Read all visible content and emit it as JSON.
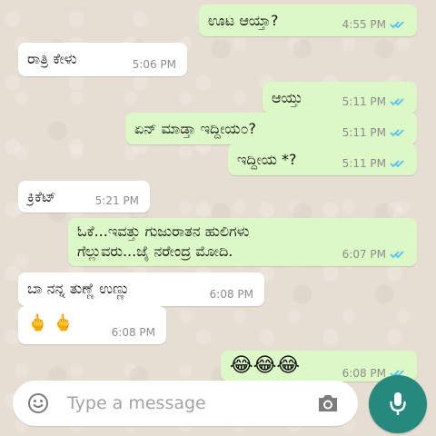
{
  "messages": [
    {
      "text": "ಊಟ ಆಯ್ತಾ?",
      "time": "4:55 PM",
      "direction": "outgoing",
      "status": "read"
    },
    {
      "text": "ರಾತ್ರಿ ಕೇಳು",
      "time": "5:06 PM",
      "direction": "incoming"
    },
    {
      "text": "ಆಯ್ತು",
      "time": "5:11 PM",
      "direction": "outgoing",
      "status": "read"
    },
    {
      "text": "ಏನ್ ಮಾಡ್ತಾ ಇದ್ದೀಯ೦?",
      "time": "5:11 PM",
      "direction": "outgoing",
      "status": "read"
    },
    {
      "text": "ಇದ್ದೀಯ *?",
      "time": "5:11 PM",
      "direction": "outgoing",
      "status": "read"
    },
    {
      "text": "ಕ್ರಿಕೆಟ್",
      "time": "5:21 PM",
      "direction": "incoming"
    },
    {
      "text_line1": "ಓಕೆ...ಇವತ್ತು ಗುಜುರಾತನ ಹುಲಿಗಳು",
      "text_line2": "ಗೆಲ್ಲುವರು...ಜೈ ನರೇಂದ್ರ ಮೋದಿ.",
      "time": "6:07 PM",
      "direction": "outgoing",
      "status": "read"
    },
    {
      "text": "ಬಾ ನನ್ನ ತುಣ್ಣೆ ಉಣ್ಣು",
      "time": "6:08 PM",
      "direction": "incoming"
    },
    {
      "text": "🖕 🖕",
      "time": "6:08 PM",
      "direction": "incoming"
    },
    {
      "text": "😂😂😂",
      "time": "6:08 PM",
      "direction": "outgoing",
      "status": "read"
    }
  ],
  "composer": {
    "placeholder": "Type a message",
    "emoji_icon": "emoji-icon",
    "camera_icon": "camera-icon",
    "mic_icon": "mic-icon"
  },
  "colors": {
    "background": "#e7ded3",
    "outgoing_bubble": "#dcf8c6",
    "incoming_bubble": "#ffffff",
    "read_tick": "#4fc3f7",
    "mic_button": "#25897e"
  }
}
